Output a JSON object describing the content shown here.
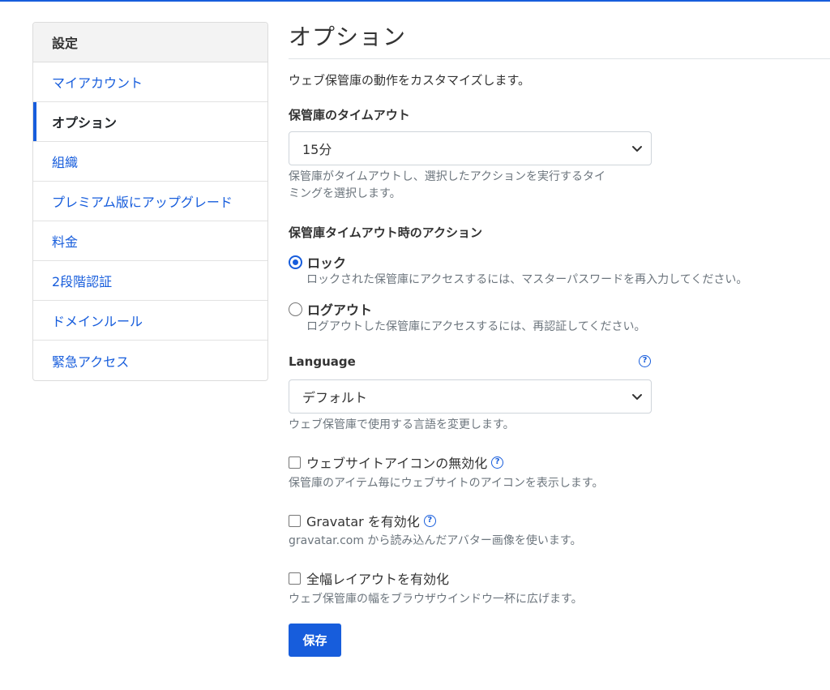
{
  "sidebar": {
    "header": "設定",
    "items": [
      {
        "label": "マイアカウント",
        "active": false
      },
      {
        "label": "オプション",
        "active": true
      },
      {
        "label": "組織",
        "active": false
      },
      {
        "label": "プレミアム版にアップグレード",
        "active": false
      },
      {
        "label": "料金",
        "active": false
      },
      {
        "label": "2段階認証",
        "active": false
      },
      {
        "label": "ドメインルール",
        "active": false
      },
      {
        "label": "緊急アクセス",
        "active": false
      }
    ]
  },
  "main": {
    "title": "オプション",
    "intro": "ウェブ保管庫の動作をカスタマイズします。",
    "timeout": {
      "label": "保管庫のタイムアウト",
      "value": "15分",
      "help_line1": "保管庫がタイムアウトし、選択したアクションを実行するタイ",
      "help_line2": "ミングを選択します。"
    },
    "timeout_action": {
      "label": "保管庫タイムアウト時のアクション",
      "options": [
        {
          "label": "ロック",
          "help": "ロックされた保管庫にアクセスするには、マスターパスワードを再入力してください。",
          "checked": true
        },
        {
          "label": "ログアウト",
          "help": "ログアウトした保管庫にアクセスするには、再認証してください。",
          "checked": false
        }
      ]
    },
    "language": {
      "label": "Language",
      "value": "デフォルト",
      "help": "ウェブ保管庫で使用する言語を変更します。"
    },
    "checkboxes": [
      {
        "label": "ウェブサイトアイコンの無効化",
        "help": "保管庫のアイテム毎にウェブサイトのアイコンを表示します。",
        "has_help_icon": true,
        "checked": false
      },
      {
        "label": "Gravatar を有効化",
        "help": "gravatar.com から読み込んだアバター画像を使います。",
        "has_help_icon": true,
        "checked": false
      },
      {
        "label": "全幅レイアウトを有効化",
        "help": "ウェブ保管庫の幅をブラウザウインドウ一杯に広げます。",
        "has_help_icon": false,
        "checked": false
      }
    ],
    "help_icon": "?",
    "save_label": "保存"
  },
  "colors": {
    "accent": "#175ddc",
    "muted": "#6c757d"
  },
  "icons": {
    "help": "question-circle-icon",
    "select": "chevron-down-icon"
  }
}
